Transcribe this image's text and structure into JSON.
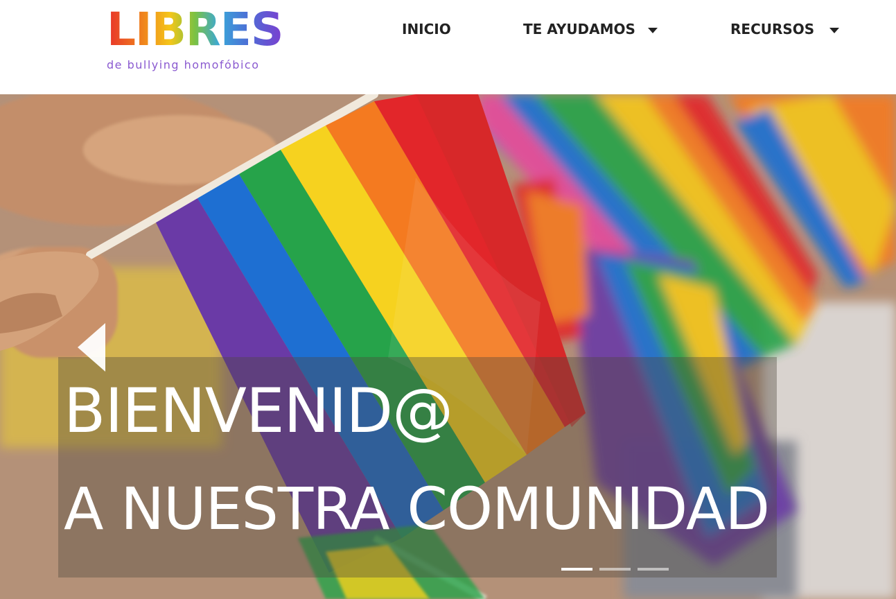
{
  "brand": {
    "wordmark": "LIBRES",
    "tagline": "de bullying homofóbico"
  },
  "nav": {
    "items": [
      {
        "label": "INICIO",
        "has_dropdown": false
      },
      {
        "label": "TE AYUDAMOS",
        "has_dropdown": true
      },
      {
        "label": "RECURSOS",
        "has_dropdown": true
      }
    ]
  },
  "hero": {
    "headline_line1": "BIENVENID@",
    "headline_line2": "A NUESTRA COMUNIDAD",
    "prev_icon": "chevron-left-icon",
    "slide_count": 3,
    "active_slide": 1
  },
  "colors": {
    "flag_red": "#e2262a",
    "flag_orange": "#f47a20",
    "flag_yellow": "#f6d21f",
    "flag_green": "#26a34a",
    "flag_blue": "#1e6fd2",
    "flag_purple": "#6a3aa6"
  }
}
